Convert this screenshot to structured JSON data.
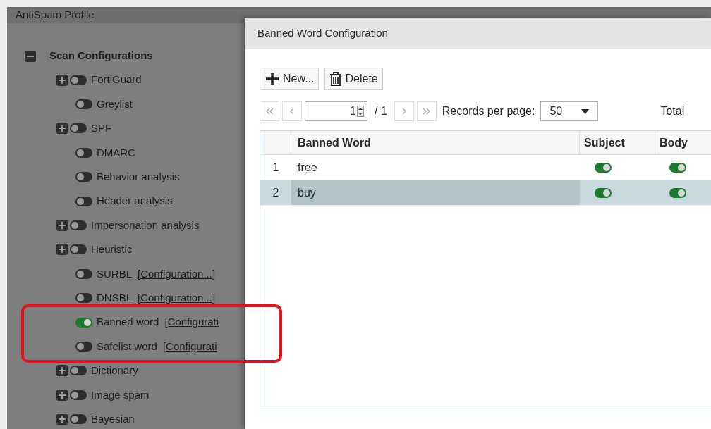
{
  "profile_panel": {
    "title": "AntiSpam Profile",
    "tree": [
      {
        "label": "Scan Configurations",
        "expanded": true,
        "children": [
          {
            "label": "FortiGuard",
            "expandable": true,
            "on": false
          },
          {
            "label": "Greylist",
            "expandable": false,
            "on": false
          },
          {
            "label": "SPF",
            "expandable": true,
            "on": false
          },
          {
            "label": "DMARC",
            "expandable": false,
            "on": false
          },
          {
            "label": "Behavior analysis",
            "expandable": false,
            "on": false
          },
          {
            "label": "Header analysis",
            "expandable": false,
            "on": false
          },
          {
            "label": "Impersonation analysis",
            "expandable": true,
            "on": false
          },
          {
            "label": "Heuristic",
            "expandable": true,
            "on": false
          },
          {
            "label": "SURBL",
            "expandable": false,
            "on": false,
            "link": "[Configuration...]"
          },
          {
            "label": "DNSBL",
            "expandable": false,
            "on": false,
            "link": "[Configuration...]"
          },
          {
            "label": "Banned word",
            "expandable": false,
            "on": true,
            "link": "[Configurati"
          },
          {
            "label": "Safelist word",
            "expandable": false,
            "on": false,
            "link": "[Configurati"
          },
          {
            "label": "Dictionary",
            "expandable": true,
            "on": false
          },
          {
            "label": "Image spam",
            "expandable": true,
            "on": false
          },
          {
            "label": "Bayesian",
            "expandable": true,
            "on": false
          }
        ]
      }
    ]
  },
  "dialog": {
    "title": "Banned Word Configuration",
    "buttons": [
      {
        "kind": "new",
        "label": "New..."
      },
      {
        "kind": "delete",
        "label": "Delete"
      }
    ],
    "pager": {
      "page": "1",
      "of": "/ 1",
      "records_label": "Records per page:",
      "records_value": "50",
      "total_label": "Total"
    },
    "table": {
      "columns": [
        "Banned Word",
        "Subject",
        "Body"
      ],
      "rows": [
        {
          "index": "1",
          "word": "free",
          "subject": true,
          "body": true,
          "selected": false
        },
        {
          "index": "2",
          "word": "buy",
          "subject": true,
          "body": true,
          "selected": true
        }
      ]
    }
  }
}
